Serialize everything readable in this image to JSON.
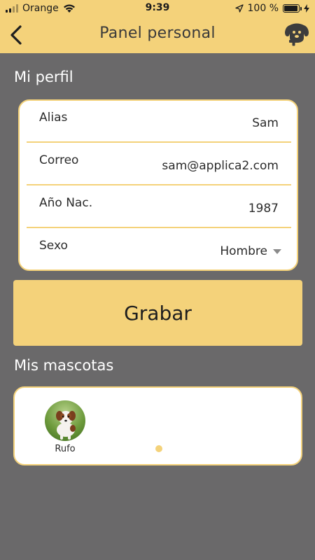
{
  "status_bar": {
    "carrier": "Orange",
    "time": "9:39",
    "battery_percent": "100 %",
    "battery_level": 100
  },
  "nav": {
    "title": "Panel personal",
    "back_icon": "chevron-left-icon",
    "action_icon": "add-pet-icon"
  },
  "profile": {
    "section_title": "Mi perfil",
    "fields": [
      {
        "label": "Alias",
        "value": "Sam"
      },
      {
        "label": "Correo",
        "value": "sam@applica2.com"
      },
      {
        "label": "Año Nac.",
        "value": "1987"
      }
    ],
    "sex": {
      "label": "Sexo",
      "value": "Hombre"
    }
  },
  "save_button": {
    "label": "Grabar"
  },
  "pets": {
    "section_title": "Mis mascotas",
    "items": [
      {
        "name": "Rufo"
      }
    ],
    "page_count": 1,
    "active_page": 1
  },
  "colors": {
    "accent": "#f4d27a",
    "background": "#6a696a",
    "card": "#ffffff",
    "text": "#2b2b2b"
  }
}
